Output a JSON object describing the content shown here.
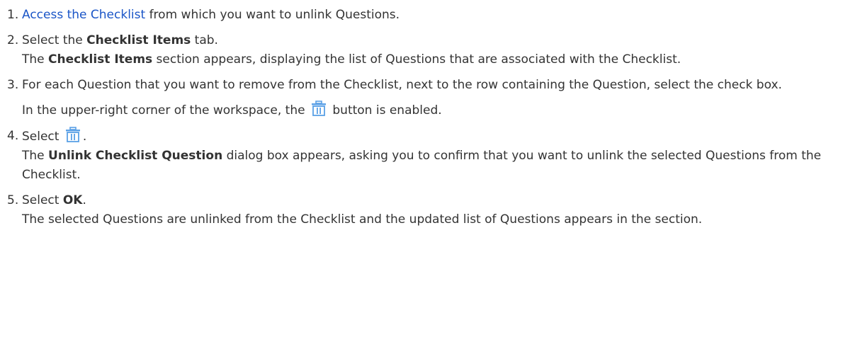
{
  "colors": {
    "link": "#1a55c7",
    "text": "#333333",
    "icon": "#5aa0e6"
  },
  "steps": [
    {
      "number": "1.",
      "link": "Access the Checklist",
      "text": " from which you want to unlink Questions."
    },
    {
      "number": "2.",
      "pre": "Select the ",
      "bold": "Checklist Items",
      "post": " tab.",
      "result_bold": "Checklist Items",
      "result_text": " section appears, displaying the list of Questions that are associated with the Checklist.",
      "result_pre": "The "
    },
    {
      "number": "3.",
      "text": "For each Question that you want to remove from the Checklist, next to the row containing the Question, select the check box.",
      "note_pre": "In the upper-right corner of the workspace, the ",
      "note_icon": "trash-icon",
      "note_post": " button is enabled."
    },
    {
      "number": "4.",
      "pre": "Select ",
      "icon": "trash-icon",
      "post": ".",
      "result_pre": "The ",
      "result_bold": "Unlink Checklist Question",
      "result_text": " dialog box appears, asking you to confirm that you want to unlink the selected Questions from the Checklist."
    },
    {
      "number": "5.",
      "pre": "Select ",
      "bold": "OK",
      "post": ".",
      "result_text": "The selected Questions are unlinked from the Checklist and the updated list of Questions appears in the section."
    }
  ]
}
